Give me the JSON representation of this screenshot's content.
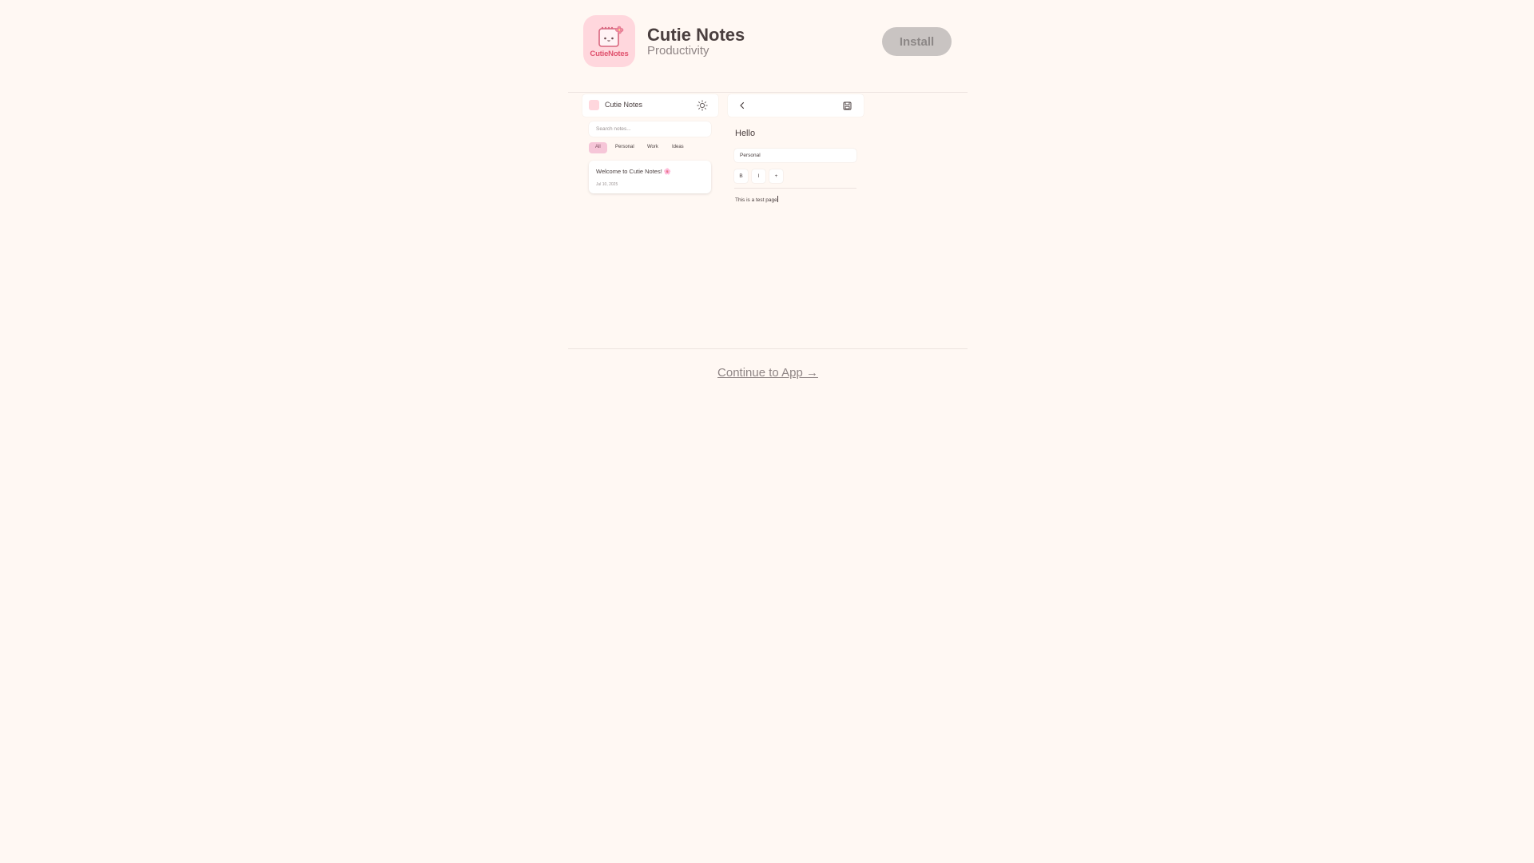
{
  "app": {
    "icon_label": "CutieNotes",
    "name": "Cutie Notes",
    "category": "Productivity"
  },
  "install_button": {
    "label": "Install"
  },
  "screenshots": {
    "list_screen": {
      "title": "Cutie Notes",
      "search_placeholder": "Search notes...",
      "chips": [
        "All",
        "Personal",
        "Work",
        "Ideas"
      ],
      "active_chip": "All",
      "note": {
        "title": "Welcome to Cutie Notes! 🌸",
        "date": "Jul 10, 2025"
      }
    },
    "editor_screen": {
      "note_title": "Hello",
      "category": "Personal",
      "format_buttons": [
        "B",
        "I",
        "+"
      ],
      "body": "This is a test page"
    }
  },
  "continue_link": {
    "label": "Continue to App →"
  },
  "colors": {
    "background": "#fff8f3",
    "icon_bg": "#ffd7dd",
    "accent": "#e0526e",
    "install_bg": "#c9c4c2",
    "active_chip": "#f6c6d8"
  }
}
